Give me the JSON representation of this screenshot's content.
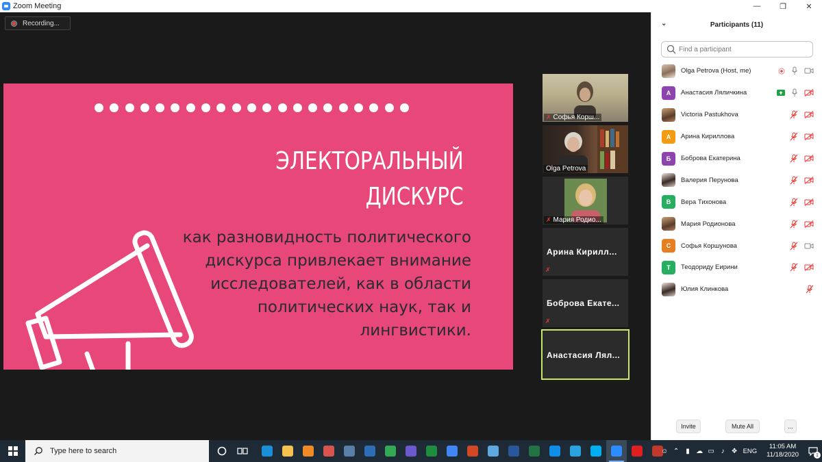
{
  "window": {
    "title": "Zoom Meeting"
  },
  "recording": {
    "label": "Recording..."
  },
  "slide": {
    "title_line1": "ЭЛЕКТОРАЛЬНЫЙ",
    "title_line2": "ДИСКУРС",
    "body_lines": [
      "как разновидность политического",
      "дискурса привлекает внимание",
      "исследователей, как в области",
      "политических наук, так и",
      "лингвистики."
    ],
    "bg_color": "#e8477a"
  },
  "thumbnails": [
    {
      "name": "Софья Корш...",
      "type": "video",
      "muted": true
    },
    {
      "name": "Olga Petrova",
      "type": "video",
      "muted": false
    },
    {
      "name": "Мария Родио...",
      "type": "video",
      "muted": true
    },
    {
      "name": "Арина Кирилл...",
      "type": "name",
      "muted": true
    },
    {
      "name": "Боброва Екате...",
      "type": "name",
      "muted": true
    },
    {
      "name": "Анастасия Лял...",
      "type": "name",
      "muted": false,
      "active": true
    }
  ],
  "participants_panel": {
    "header": "Participants (11)",
    "search_placeholder": "Find a participant",
    "participants": [
      {
        "name": "Olga Petrova (Host, me)",
        "avatar": "photo",
        "letter": "",
        "color": "",
        "mic": "on",
        "video": "on",
        "recording": true
      },
      {
        "name": "Анастасия Ляличкина",
        "avatar": "letter",
        "letter": "А",
        "color": "#8e44ad",
        "mic": "on",
        "video": "off",
        "sharing": true
      },
      {
        "name": "Victoria Pastukhova",
        "avatar": "photo2",
        "letter": "",
        "color": "",
        "mic": "off",
        "video": "off"
      },
      {
        "name": "Арина Кириллова",
        "avatar": "letter",
        "letter": "А",
        "color": "#f39c12",
        "mic": "off",
        "video": "off"
      },
      {
        "name": "Боброва Екатерина",
        "avatar": "letter",
        "letter": "Б",
        "color": "#8e44ad",
        "mic": "off",
        "video": "off"
      },
      {
        "name": "Валерия Перунова",
        "avatar": "photo3",
        "letter": "",
        "color": "",
        "mic": "off",
        "video": "off"
      },
      {
        "name": "Вера Тихонова",
        "avatar": "letter",
        "letter": "В",
        "color": "#27ae60",
        "mic": "off",
        "video": "off"
      },
      {
        "name": "Мария Родионова",
        "avatar": "photo2",
        "letter": "",
        "color": "",
        "mic": "off",
        "video": "off"
      },
      {
        "name": "Софья Коршунова",
        "avatar": "letter",
        "letter": "С",
        "color": "#e67e22",
        "mic": "off",
        "video": "on"
      },
      {
        "name": "Теодориду Еирини",
        "avatar": "letter",
        "letter": "Т",
        "color": "#27ae60",
        "mic": "off",
        "video": "off"
      },
      {
        "name": "Юлия Клинкова",
        "avatar": "photo3",
        "letter": "",
        "color": "",
        "mic": "off",
        "video": "none"
      }
    ],
    "invite_label": "Invite",
    "mute_all_label": "Mute All",
    "more_label": "..."
  },
  "taskbar": {
    "search_placeholder": "Type here to search",
    "language": "ENG",
    "time": "11:05 AM",
    "date": "11/18/2020",
    "notification_count": "1",
    "apps": [
      {
        "icon": "edge-icon",
        "color": "#1a8fd8"
      },
      {
        "icon": "file-explorer-icon",
        "color": "#f2c14e"
      },
      {
        "icon": "vlc-icon",
        "color": "#f08a24"
      },
      {
        "icon": "app-icon",
        "color": "#d9534f"
      },
      {
        "icon": "calculator-icon",
        "color": "#5a7fa6"
      },
      {
        "icon": "lock-app-icon",
        "color": "#2c6db5"
      },
      {
        "icon": "chrome-icon",
        "color": "#34a853"
      },
      {
        "icon": "app2-icon",
        "color": "#6a5acd"
      },
      {
        "icon": "sheets-icon",
        "color": "#1e8e3e"
      },
      {
        "icon": "docs-icon",
        "color": "#4285f4"
      },
      {
        "icon": "powerpoint-icon",
        "color": "#d24726"
      },
      {
        "icon": "weather-icon",
        "color": "#5fa8e0"
      },
      {
        "icon": "word-icon",
        "color": "#2b579a"
      },
      {
        "icon": "excel-icon",
        "color": "#217346"
      },
      {
        "icon": "teamviewer-icon",
        "color": "#0e8ee9"
      },
      {
        "icon": "telegram-icon",
        "color": "#2aa3e0"
      },
      {
        "icon": "skype-icon",
        "color": "#00aff0"
      },
      {
        "icon": "zoom-icon",
        "color": "#2d8cff",
        "active": true
      },
      {
        "icon": "acrobat-icon",
        "color": "#e02020"
      },
      {
        "icon": "app3-icon",
        "color": "#c0392b"
      }
    ]
  }
}
